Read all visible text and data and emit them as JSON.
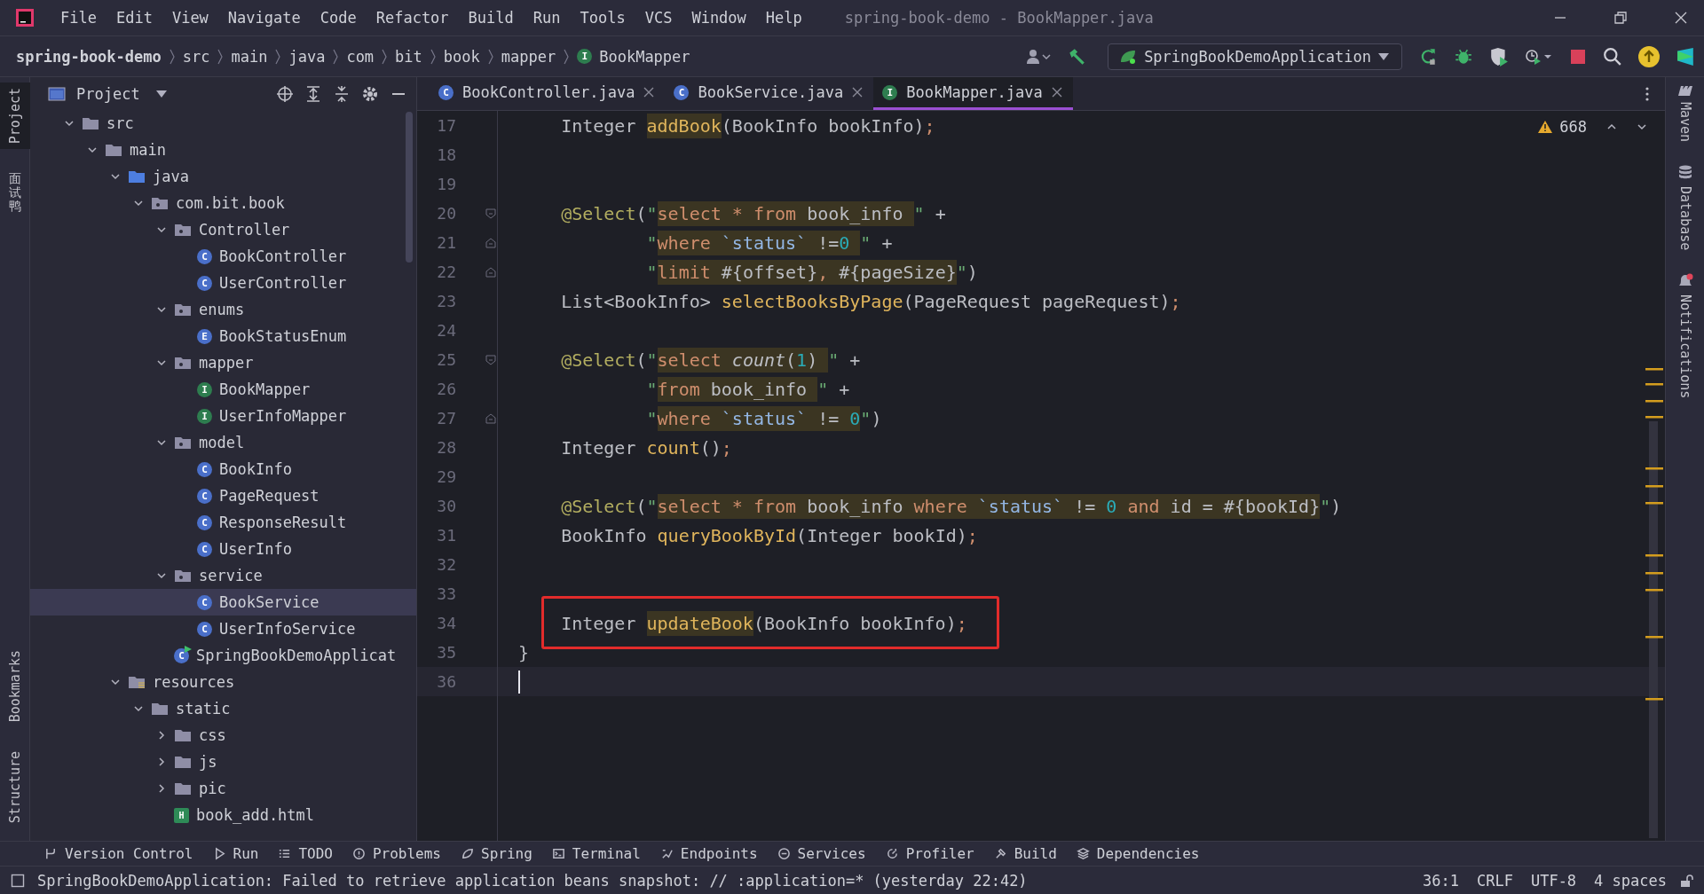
{
  "window": {
    "title": "spring-book-demo - BookMapper.java"
  },
  "menu": [
    "File",
    "Edit",
    "View",
    "Navigate",
    "Code",
    "Refactor",
    "Build",
    "Run",
    "Tools",
    "VCS",
    "Window",
    "Help"
  ],
  "breadcrumb": [
    {
      "label": "spring-book-demo"
    },
    {
      "label": "src"
    },
    {
      "label": "main"
    },
    {
      "label": "java"
    },
    {
      "label": "com"
    },
    {
      "label": "bit"
    },
    {
      "label": "book"
    },
    {
      "label": "mapper"
    },
    {
      "label": "BookMapper",
      "letter": "I"
    }
  ],
  "run_config": "SpringBookDemoApplication",
  "left_stripe": [
    {
      "label": "Project",
      "kind": "latin",
      "selected": true
    },
    {
      "label": "面试鸭",
      "kind": "cjk",
      "selected": false
    },
    {
      "label": "Bookmarks",
      "kind": "latin",
      "selected": false
    },
    {
      "label": "Structure",
      "kind": "latin",
      "selected": false
    }
  ],
  "right_stripe": [
    "Maven",
    "Database",
    "Notifications"
  ],
  "project_panel": {
    "title": "Project",
    "tree": [
      {
        "label": "src",
        "kind": "folder",
        "selected": false,
        "expanded": true,
        "children": [
          {
            "label": "main",
            "kind": "folder",
            "selected": false,
            "expanded": true,
            "children": [
              {
                "label": "java",
                "kind": "source",
                "selected": false,
                "expanded": true,
                "children": [
                  {
                    "label": "com.bit.book",
                    "kind": "package",
                    "selected": false,
                    "expanded": true,
                    "children": [
                      {
                        "label": "Controller",
                        "kind": "package",
                        "selected": false,
                        "expanded": true,
                        "children": [
                          {
                            "label": "BookController",
                            "kind": "class",
                            "letter": "C",
                            "selected": false
                          },
                          {
                            "label": "UserController",
                            "kind": "class",
                            "letter": "C",
                            "selected": false
                          }
                        ]
                      },
                      {
                        "label": "enums",
                        "kind": "package",
                        "selected": false,
                        "expanded": true,
                        "children": [
                          {
                            "label": "BookStatusEnum",
                            "kind": "class",
                            "letter": "E",
                            "selected": false
                          }
                        ]
                      },
                      {
                        "label": "mapper",
                        "kind": "package",
                        "selected": false,
                        "expanded": true,
                        "children": [
                          {
                            "label": "BookMapper",
                            "kind": "interface",
                            "letter": "I",
                            "selected": false
                          },
                          {
                            "label": "UserInfoMapper",
                            "kind": "interface",
                            "letter": "I",
                            "selected": false
                          }
                        ]
                      },
                      {
                        "label": "model",
                        "kind": "package",
                        "selected": false,
                        "expanded": true,
                        "children": [
                          {
                            "label": "BookInfo",
                            "kind": "class",
                            "letter": "C",
                            "selected": false
                          },
                          {
                            "label": "PageRequest",
                            "kind": "class",
                            "letter": "C",
                            "selected": false
                          },
                          {
                            "label": "ResponseResult",
                            "kind": "class",
                            "letter": "C",
                            "selected": false
                          },
                          {
                            "label": "UserInfo",
                            "kind": "class",
                            "letter": "C",
                            "selected": false
                          }
                        ]
                      },
                      {
                        "label": "service",
                        "kind": "package",
                        "selected": false,
                        "expanded": true,
                        "children": [
                          {
                            "label": "BookService",
                            "kind": "class",
                            "letter": "C",
                            "selected": true
                          },
                          {
                            "label": "UserInfoService",
                            "kind": "class",
                            "letter": "C",
                            "selected": false
                          }
                        ]
                      },
                      {
                        "label": "SpringBookDemoApplicat",
                        "kind": "app",
                        "letter": "C",
                        "selected": false
                      }
                    ]
                  }
                ]
              },
              {
                "label": "resources",
                "kind": "resources",
                "selected": false,
                "expanded": true,
                "children": [
                  {
                    "label": "static",
                    "kind": "folder",
                    "selected": false,
                    "expanded": true,
                    "children": [
                      {
                        "label": "css",
                        "kind": "folder",
                        "selected": false,
                        "expanded": false
                      },
                      {
                        "label": "js",
                        "kind": "folder",
                        "selected": false,
                        "expanded": false
                      },
                      {
                        "label": "pic",
                        "kind": "folder",
                        "selected": false,
                        "expanded": false
                      },
                      {
                        "label": "book_add.html",
                        "kind": "html",
                        "letter": "H",
                        "selected": false
                      }
                    ]
                  }
                ]
              }
            ]
          }
        ]
      }
    ]
  },
  "tabs": [
    {
      "label": "BookController.java",
      "letter": "C",
      "kind": "class",
      "selected": false
    },
    {
      "label": "BookService.java",
      "letter": "C",
      "kind": "class",
      "selected": false
    },
    {
      "label": "BookMapper.java",
      "letter": "I",
      "kind": "interface",
      "selected": true
    }
  ],
  "editor": {
    "warnings": "668",
    "lines": [
      {
        "number": "17",
        "fold_start": false,
        "fold_end": false,
        "boxed": false,
        "current": false,
        "segments": [
          {
            "highlighted": false,
            "tokens": [
              {
                "text": "    Integer ",
                "kind": "plain"
              }
            ]
          },
          {
            "highlighted": true,
            "tokens": [
              {
                "text": "addBook",
                "kind": "method"
              }
            ]
          },
          {
            "highlighted": false,
            "tokens": [
              {
                "text": "(BookInfo bookInfo)",
                "kind": "plain"
              },
              {
                "text": ";",
                "kind": "punct"
              }
            ]
          }
        ]
      },
      {
        "number": "18",
        "fold_start": false,
        "fold_end": false,
        "boxed": false,
        "current": false
      },
      {
        "number": "19",
        "fold_start": false,
        "fold_end": false,
        "boxed": false,
        "current": false
      },
      {
        "number": "20",
        "fold_start": true,
        "fold_end": false,
        "boxed": false,
        "current": false,
        "segments": [
          {
            "highlighted": false,
            "tokens": [
              {
                "text": "    @Select",
                "kind": "annotation"
              },
              {
                "text": "(",
                "kind": "plain"
              },
              {
                "text": "\"",
                "kind": "quote"
              }
            ]
          },
          {
            "highlighted": true,
            "tokens": [
              {
                "text": "select ",
                "kind": "keyword"
              },
              {
                "text": "* ",
                "kind": "keyword"
              },
              {
                "text": "from ",
                "kind": "keyword"
              },
              {
                "text": "book_info ",
                "kind": "plain"
              }
            ]
          },
          {
            "highlighted": false,
            "tokens": [
              {
                "text": "\"",
                "kind": "quote"
              },
              {
                "text": " +",
                "kind": "plain"
              }
            ]
          }
        ]
      },
      {
        "number": "21",
        "fold_start": false,
        "fold_end": true,
        "boxed": false,
        "current": false,
        "segments": [
          {
            "highlighted": false,
            "tokens": [
              {
                "text": "            \"",
                "kind": "quote"
              }
            ]
          },
          {
            "highlighted": true,
            "tokens": [
              {
                "text": "where ",
                "kind": "keyword"
              },
              {
                "text": "`status`",
                "kind": "ident"
              },
              {
                "text": " !=",
                "kind": "plain"
              },
              {
                "text": "0 ",
                "kind": "number"
              }
            ]
          },
          {
            "highlighted": false,
            "tokens": [
              {
                "text": "\"",
                "kind": "quote"
              },
              {
                "text": " +",
                "kind": "plain"
              }
            ]
          }
        ]
      },
      {
        "number": "22",
        "fold_start": false,
        "fold_end": true,
        "boxed": false,
        "current": false,
        "segments": [
          {
            "highlighted": false,
            "tokens": [
              {
                "text": "            \"",
                "kind": "quote"
              }
            ]
          },
          {
            "highlighted": true,
            "tokens": [
              {
                "text": "limit",
                "kind": "keyword"
              },
              {
                "text": " #{offset}",
                "kind": "plain"
              },
              {
                "text": ",",
                "kind": "keyword"
              },
              {
                "text": " #{pageSize}",
                "kind": "plain"
              }
            ]
          },
          {
            "highlighted": false,
            "tokens": [
              {
                "text": "\"",
                "kind": "quote"
              },
              {
                "text": ")",
                "kind": "plain"
              }
            ]
          }
        ]
      },
      {
        "number": "23",
        "fold_start": false,
        "fold_end": false,
        "boxed": false,
        "current": false,
        "segments": [
          {
            "highlighted": false,
            "tokens": [
              {
                "text": "    List<BookInfo> ",
                "kind": "plain"
              },
              {
                "text": "selectBooksByPage",
                "kind": "method"
              },
              {
                "text": "(PageRequest pageRequest)",
                "kind": "plain"
              },
              {
                "text": ";",
                "kind": "punct"
              }
            ]
          }
        ]
      },
      {
        "number": "24",
        "fold_start": false,
        "fold_end": false,
        "boxed": false,
        "current": false
      },
      {
        "number": "25",
        "fold_start": true,
        "fold_end": false,
        "boxed": false,
        "current": false,
        "segments": [
          {
            "highlighted": false,
            "tokens": [
              {
                "text": "    @Select",
                "kind": "annotation"
              },
              {
                "text": "(",
                "kind": "plain"
              },
              {
                "text": "\"",
                "kind": "quote"
              }
            ]
          },
          {
            "highlighted": true,
            "tokens": [
              {
                "text": "select ",
                "kind": "keyword"
              },
              {
                "text": "count",
                "kind": "italic"
              },
              {
                "text": "(",
                "kind": "plain"
              },
              {
                "text": "1",
                "kind": "number"
              },
              {
                "text": ") ",
                "kind": "plain"
              }
            ]
          },
          {
            "highlighted": false,
            "tokens": [
              {
                "text": "\"",
                "kind": "quote"
              },
              {
                "text": " +",
                "kind": "plain"
              }
            ]
          }
        ]
      },
      {
        "number": "26",
        "fold_start": false,
        "fold_end": false,
        "boxed": false,
        "current": false,
        "segments": [
          {
            "highlighted": false,
            "tokens": [
              {
                "text": "            \"",
                "kind": "quote"
              }
            ]
          },
          {
            "highlighted": true,
            "tokens": [
              {
                "text": "from ",
                "kind": "keyword"
              },
              {
                "text": "book_info ",
                "kind": "plain"
              }
            ]
          },
          {
            "highlighted": false,
            "tokens": [
              {
                "text": "\"",
                "kind": "quote"
              },
              {
                "text": " +",
                "kind": "plain"
              }
            ]
          }
        ]
      },
      {
        "number": "27",
        "fold_start": false,
        "fold_end": true,
        "boxed": false,
        "current": false,
        "segments": [
          {
            "highlighted": false,
            "tokens": [
              {
                "text": "            \"",
                "kind": "quote"
              }
            ]
          },
          {
            "highlighted": true,
            "tokens": [
              {
                "text": "where ",
                "kind": "keyword"
              },
              {
                "text": "`status`",
                "kind": "ident"
              },
              {
                "text": " != ",
                "kind": "plain"
              },
              {
                "text": "0",
                "kind": "number"
              }
            ]
          },
          {
            "highlighted": false,
            "tokens": [
              {
                "text": "\"",
                "kind": "quote"
              },
              {
                "text": ")",
                "kind": "plain"
              }
            ]
          }
        ]
      },
      {
        "number": "28",
        "fold_start": false,
        "fold_end": false,
        "boxed": false,
        "current": false,
        "segments": [
          {
            "highlighted": false,
            "tokens": [
              {
                "text": "    Integer ",
                "kind": "plain"
              },
              {
                "text": "count",
                "kind": "method"
              },
              {
                "text": "()",
                "kind": "plain"
              },
              {
                "text": ";",
                "kind": "punct"
              }
            ]
          }
        ]
      },
      {
        "number": "29",
        "fold_start": false,
        "fold_end": false,
        "boxed": false,
        "current": false
      },
      {
        "number": "30",
        "fold_start": false,
        "fold_end": false,
        "boxed": false,
        "current": false,
        "segments": [
          {
            "highlighted": false,
            "tokens": [
              {
                "text": "    @Select",
                "kind": "annotation"
              },
              {
                "text": "(",
                "kind": "plain"
              },
              {
                "text": "\"",
                "kind": "quote"
              }
            ]
          },
          {
            "highlighted": true,
            "tokens": [
              {
                "text": "select ",
                "kind": "keyword"
              },
              {
                "text": "* ",
                "kind": "keyword"
              },
              {
                "text": "from ",
                "kind": "keyword"
              },
              {
                "text": "book_info ",
                "kind": "plain"
              },
              {
                "text": "where ",
                "kind": "keyword"
              },
              {
                "text": "`status`",
                "kind": "ident"
              },
              {
                "text": " != ",
                "kind": "plain"
              },
              {
                "text": "0 ",
                "kind": "number"
              },
              {
                "text": "and ",
                "kind": "keyword"
              },
              {
                "text": "id = #{bookId}",
                "kind": "plain"
              }
            ]
          },
          {
            "highlighted": false,
            "tokens": [
              {
                "text": "\"",
                "kind": "quote"
              },
              {
                "text": ")",
                "kind": "plain"
              }
            ]
          }
        ]
      },
      {
        "number": "31",
        "fold_start": false,
        "fold_end": false,
        "boxed": false,
        "current": false,
        "segments": [
          {
            "highlighted": false,
            "tokens": [
              {
                "text": "    BookInfo ",
                "kind": "plain"
              },
              {
                "text": "queryBookById",
                "kind": "method"
              },
              {
                "text": "(Integer bookId)",
                "kind": "plain"
              },
              {
                "text": ";",
                "kind": "punct"
              }
            ]
          }
        ]
      },
      {
        "number": "32",
        "fold_start": false,
        "fold_end": false,
        "boxed": false,
        "current": false
      },
      {
        "number": "33",
        "fold_start": false,
        "fold_end": false,
        "boxed": false,
        "current": false
      },
      {
        "number": "34",
        "fold_start": false,
        "fold_end": false,
        "boxed": true,
        "current": false,
        "segments": [
          {
            "highlighted": false,
            "tokens": [
              {
                "text": "    Integer ",
                "kind": "plain"
              }
            ]
          },
          {
            "highlighted": true,
            "tokens": [
              {
                "text": "updateBook",
                "kind": "method"
              }
            ]
          },
          {
            "highlighted": false,
            "tokens": [
              {
                "text": "(BookInfo bookInfo)",
                "kind": "plain"
              },
              {
                "text": ";",
                "kind": "punct"
              }
            ]
          }
        ]
      },
      {
        "number": "35",
        "fold_start": false,
        "fold_end": false,
        "boxed": false,
        "current": false,
        "segments": [
          {
            "highlighted": false,
            "tokens": [
              {
                "text": "}",
                "kind": "plain"
              }
            ]
          }
        ]
      },
      {
        "number": "36",
        "fold_start": false,
        "fold_end": false,
        "boxed": false,
        "current": true
      }
    ]
  },
  "tool_windows": [
    "Version Control",
    "Run",
    "TODO",
    "Problems",
    "Spring",
    "Terminal",
    "Endpoints",
    "Services",
    "Profiler",
    "Build",
    "Dependencies"
  ],
  "status_bar": {
    "message": "SpringBookDemoApplication: Failed to retrieve application beans snapshot: // :application=* (yesterday 22:42)",
    "items": [
      "36:1",
      "CRLF",
      "UTF-8",
      "4 spaces"
    ]
  }
}
